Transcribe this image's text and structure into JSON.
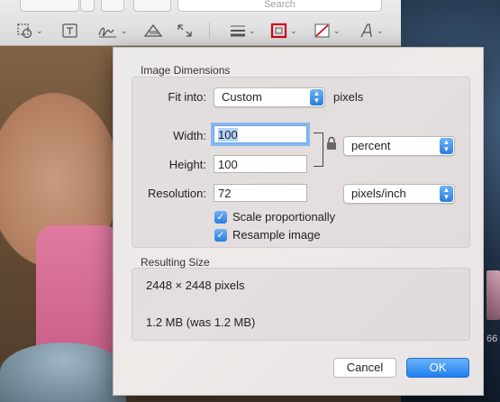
{
  "toolbar": {
    "search_placeholder": "Search",
    "tools": [
      {
        "name": "selection-tool",
        "icon": "lasso-icon"
      },
      {
        "name": "text-tool",
        "icon": "text-box-icon"
      },
      {
        "name": "sign-tool",
        "icon": "signature-icon"
      },
      {
        "name": "adjust-color-tool",
        "icon": "prism-icon"
      },
      {
        "name": "adjust-size-tool",
        "icon": "resize-icon"
      },
      {
        "name": "shape-style-tool",
        "icon": "line-weight-icon"
      },
      {
        "name": "border-color-tool",
        "icon": "border-color-icon"
      },
      {
        "name": "fill-color-tool",
        "icon": "fill-color-icon"
      },
      {
        "name": "text-style-tool",
        "icon": "text-style-icon"
      }
    ],
    "border_color": "#d0021b"
  },
  "dialog": {
    "dimensions_title": "Image Dimensions",
    "fit_into_label": "Fit into:",
    "fit_into_value": "Custom",
    "fit_into_unit": "pixels",
    "width_label": "Width:",
    "width_value": "100",
    "height_label": "Height:",
    "height_value": "100",
    "unit_value": "percent",
    "resolution_label": "Resolution:",
    "resolution_value": "72",
    "resolution_unit": "pixels/inch",
    "scale_label": "Scale proportionally",
    "scale_checked": true,
    "resample_label": "Resample image",
    "resample_checked": true,
    "resulting_title": "Resulting Size",
    "result_pixels": "2448 × 2448 pixels",
    "result_size": "1.2 MB (was 1.2 MB)",
    "cancel_label": "Cancel",
    "ok_label": "OK"
  },
  "background": {
    "thumb_label": "66"
  },
  "colors": {
    "accent": "#2a7de1",
    "focus_ring": "#87b7ef"
  }
}
